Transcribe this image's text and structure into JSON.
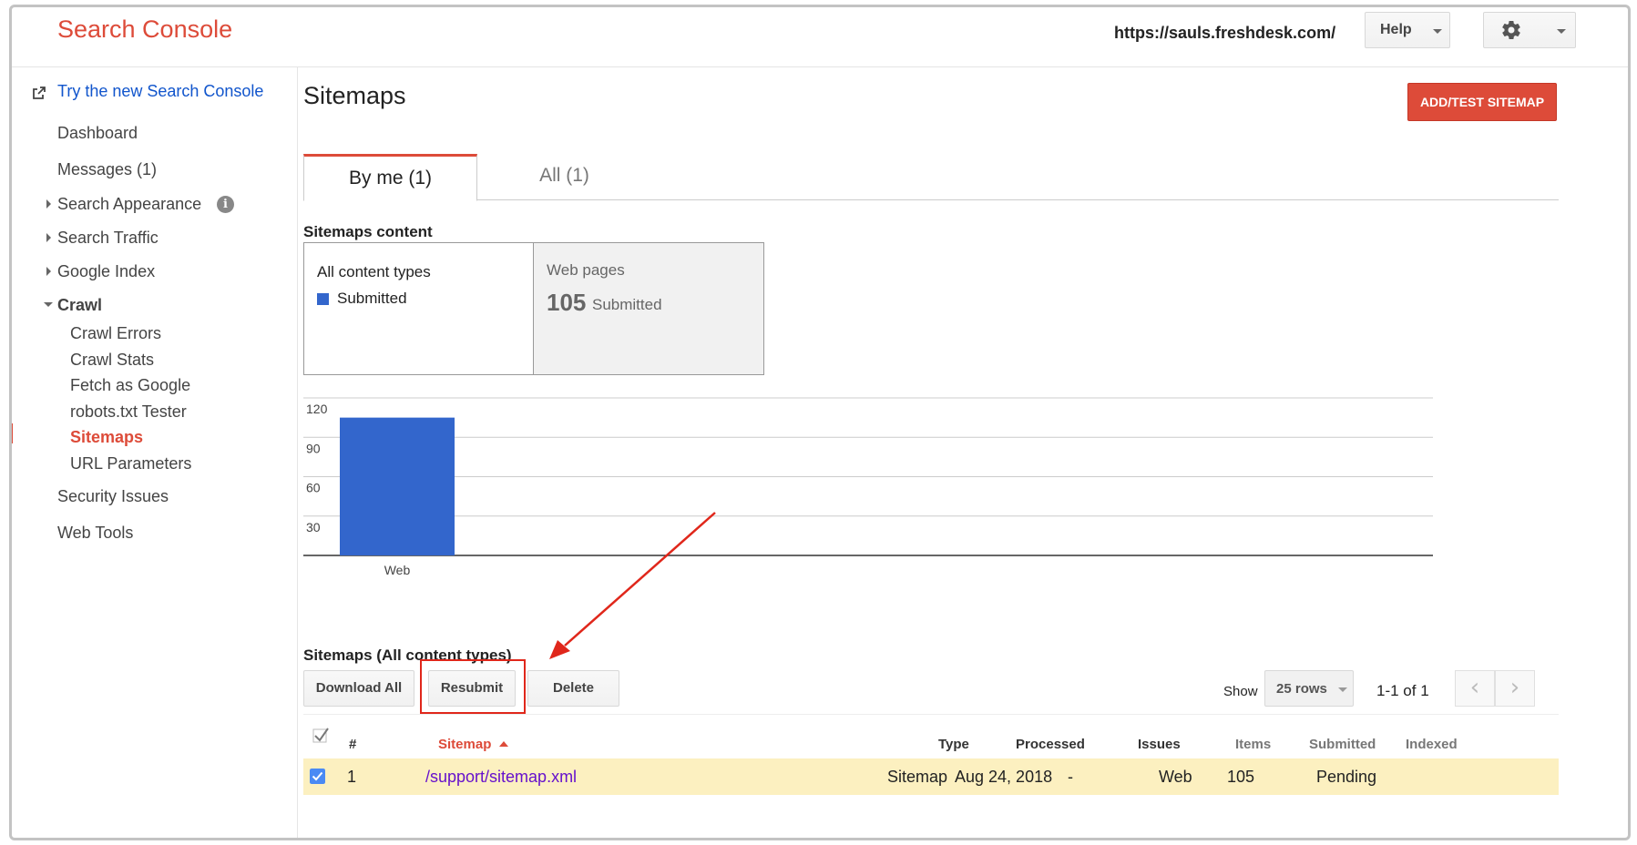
{
  "header": {
    "app_title": "Search Console",
    "site_url": "https://sauls.freshdesk.com/",
    "help_label": "Help"
  },
  "sidebar": {
    "new_console_link": "Try the new Search Console",
    "items": {
      "dashboard": "Dashboard",
      "messages": "Messages (1)",
      "search_appearance": "Search Appearance",
      "search_traffic": "Search Traffic",
      "google_index": "Google Index",
      "crawl": "Crawl",
      "crawl_errors": "Crawl Errors",
      "crawl_stats": "Crawl Stats",
      "fetch_as_google": "Fetch as Google",
      "robots_tester": "robots.txt Tester",
      "sitemaps": "Sitemaps",
      "url_parameters": "URL Parameters",
      "security_issues": "Security Issues",
      "web_tools": "Web Tools"
    }
  },
  "main": {
    "title": "Sitemaps",
    "add_button": "ADD/TEST SITEMAP",
    "tabs": [
      "By me (1)",
      "All (1)"
    ],
    "content_heading": "Sitemaps content",
    "content_types": {
      "all_label": "All content types",
      "legend_label": "Submitted",
      "web_label": "Web pages",
      "web_count": "105",
      "web_count_label": "Submitted"
    },
    "table_heading": "Sitemaps (All content types)",
    "buttons": {
      "download_all": "Download All",
      "resubmit": "Resubmit",
      "delete": "Delete"
    },
    "show_label": "Show",
    "rows_label": "25 rows",
    "pager_label": "1-1 of 1",
    "columns": [
      "#",
      "Sitemap",
      "Type",
      "Processed",
      "Issues",
      "Items",
      "Submitted",
      "Indexed"
    ],
    "rows": [
      {
        "num": "1",
        "sitemap": "/support/sitemap.xml",
        "type": "Sitemap",
        "processed": "Aug 24, 2018",
        "issues": "-",
        "items": "Web",
        "submitted": "105",
        "indexed": "Pending"
      }
    ]
  },
  "chart_data": {
    "type": "bar",
    "categories": [
      "Web"
    ],
    "series": [
      {
        "name": "Submitted",
        "values": [
          105
        ]
      }
    ],
    "ylim": [
      0,
      120
    ],
    "yticks": [
      "30",
      "60",
      "90",
      "120"
    ],
    "grid": true,
    "color": "#3366cc"
  },
  "colors": {
    "brand_red": "#dd4b39",
    "link_blue": "#1155cc",
    "bar_blue": "#3366cc",
    "row_highlight": "#fcf0c0",
    "annotation_red": "#e0271b"
  }
}
